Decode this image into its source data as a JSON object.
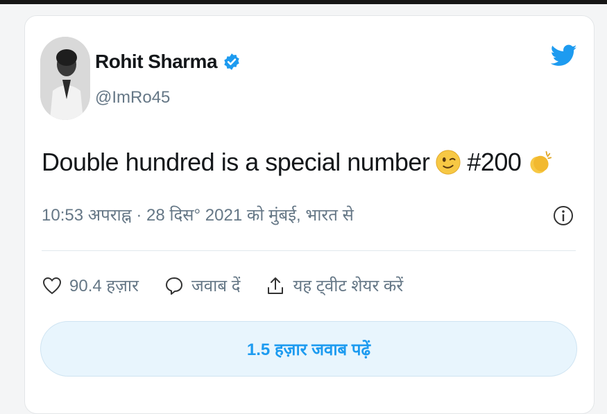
{
  "author": {
    "name": "Rohit Sharma",
    "handle": "@ImRo45",
    "verified": true
  },
  "tweet": {
    "text": "Double hundred is a special number",
    "emoji_1": "winking-face",
    "hashtag": "#200",
    "emoji_2": "clapping-hands"
  },
  "meta": {
    "timestamp": "10:53 अपराह्न · 28 दिस° 2021 को मुंबई, भारत से"
  },
  "actions": {
    "likes": "90.4 हज़ार",
    "reply_label": "जवाब दें",
    "share_label": "यह ट्वीट शेयर करें"
  },
  "replies_button": {
    "label": "1.5 हज़ार जवाब पढ़ें"
  },
  "colors": {
    "accent": "#1d9bf0",
    "text": "#14171a",
    "muted": "#657786"
  }
}
